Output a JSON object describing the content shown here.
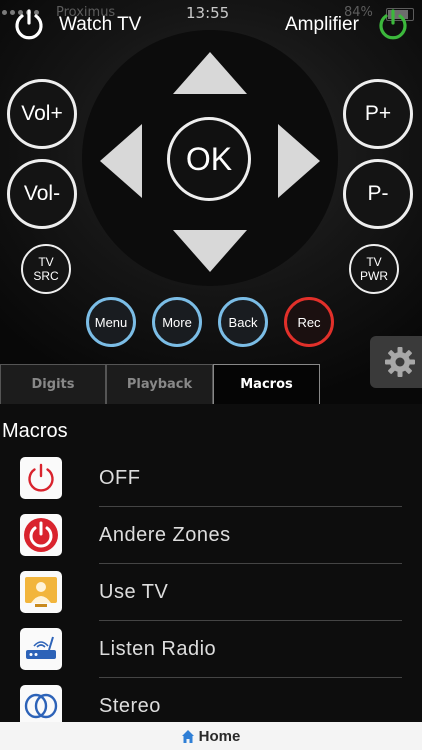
{
  "status": {
    "carrier": "Proximus",
    "time": "13:55",
    "battery": "84%"
  },
  "top_bar": {
    "left_label": "Watch TV",
    "right_label": "Amplifier"
  },
  "remote": {
    "ok": "OK",
    "vol_up": "Vol+",
    "vol_down": "Vol-",
    "prog_up": "P+",
    "prog_down": "P-",
    "tv_src": [
      "TV",
      "SRC"
    ],
    "tv_pwr": [
      "TV",
      "PWR"
    ],
    "menu": "Menu",
    "more": "More",
    "back": "Back",
    "rec": "Rec"
  },
  "tabs": [
    "Digits",
    "Playback",
    "Macros"
  ],
  "active_tab": "Macros",
  "macros": {
    "title": "Macros",
    "items": [
      {
        "label": "OFF",
        "icon": "power-outline-icon"
      },
      {
        "label": "Andere Zones",
        "icon": "power-filled-icon"
      },
      {
        "label": "Use TV",
        "icon": "tv-person-icon"
      },
      {
        "label": "Listen Radio",
        "icon": "radio-router-icon"
      },
      {
        "label": "Stereo",
        "icon": "stereo-rings-icon"
      }
    ]
  },
  "bottom_nav": {
    "home": "Home"
  },
  "colors": {
    "fn_border": "#7bbde6",
    "rec_border": "#e2302a",
    "power_green": "#3cb83c",
    "macro_red": "#d9232d"
  }
}
